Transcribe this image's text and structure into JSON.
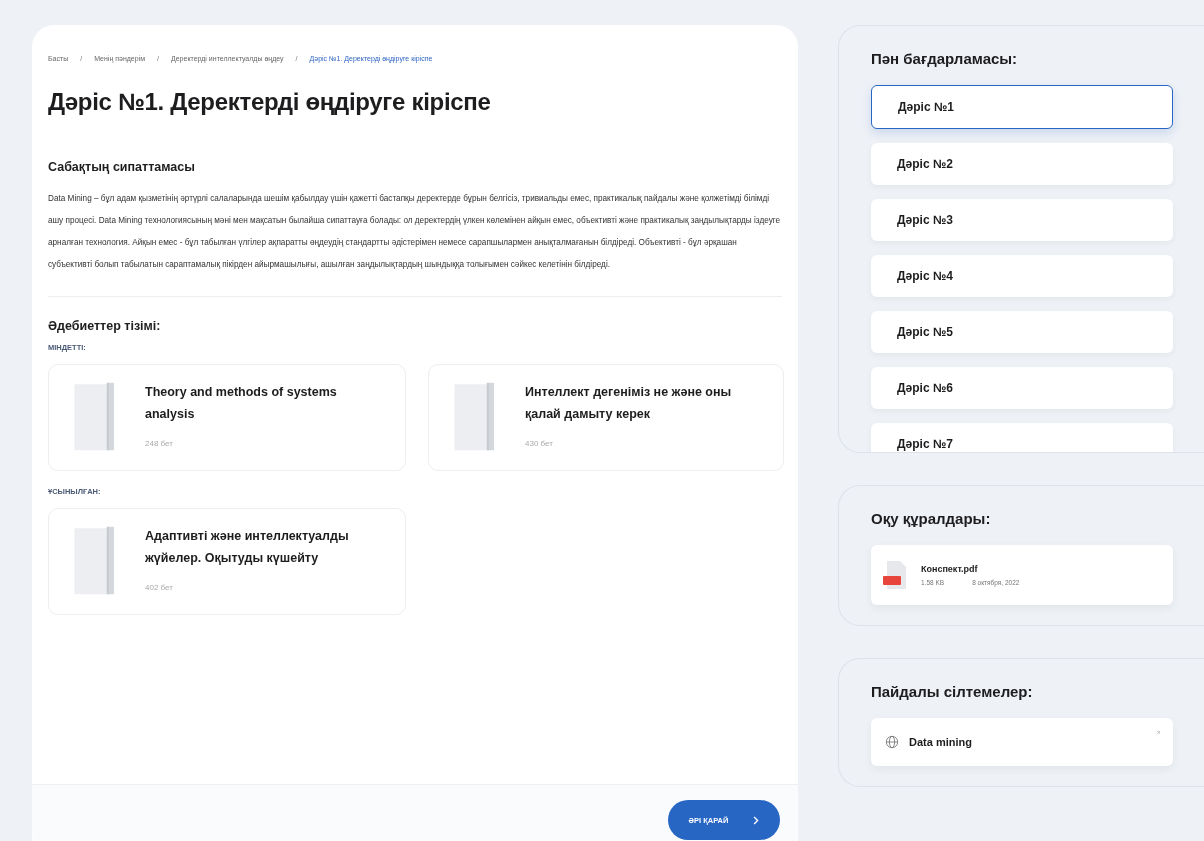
{
  "breadcrumb_separator": "/",
  "breadcrumbs": [
    {
      "label": "Басты",
      "current": false
    },
    {
      "label": "Менің пәндерім",
      "current": false
    },
    {
      "label": "Деректерді интеллектуалды өңдеу",
      "current": false
    },
    {
      "label": "Дәріс №1. Деректерді өңдіруге кіріспе",
      "current": true
    }
  ],
  "title": "Дәріс №1. Деректерді өңдіруге кіріспе",
  "description": {
    "heading": "Сабақтың сипаттамасы",
    "text": "Data Mining – бұл адам қызметінің әртүрлі салаларында шешім қабылдау үшін қажетті бастапқы деректерде бұрын белгісіз, тривиальды емес, практикалық пайдалы және қолжетімді білімді ашу процесі. Data Mining технологиясының мәні мен мақсатын былайша сипаттауға болады: ол деректердің үлкен көлемінен айқын емес, объективті және практикалық заңдылықтарды іздеуге арналған технология. Айқын емес - бұл табылған үлгілер ақпаратты өңдеудің стандартты әдістерімен немесе сарапшылармен анықталмағанын білдіреді. Объективті - бұл әрқашан субъективті болып табылатын сараптамалық пікірден айырмашылығы, ашылған заңдылықтардың шындыққа толығымен сәйкес келетінін білдіреді."
  },
  "literature": {
    "heading": "Әдебиеттер тізімі:",
    "groups": [
      {
        "label": "МІНДЕТТІ:",
        "books": [
          {
            "title": "Theory and methods of systems analysis",
            "pages": "248 бет"
          },
          {
            "title": "Интеллект дегеніміз не және оны қалай дамыту керек",
            "pages": "430 бет"
          }
        ]
      },
      {
        "label": "ҰСЫНЫЛҒАН:",
        "books": [
          {
            "title": "Адаптивті және интеллектуалды жүйелер. Оқытуды күшейту",
            "pages": "402 бет"
          }
        ]
      }
    ]
  },
  "next_button": "ӘРІ ҚАРАЙ",
  "program": {
    "heading": "Пән бағдарламасы:",
    "lessons": [
      {
        "label": "Дәріс №1",
        "selected": true
      },
      {
        "label": "Дәріс №2",
        "selected": false
      },
      {
        "label": "Дәріс №3",
        "selected": false
      },
      {
        "label": "Дәріс №4",
        "selected": false
      },
      {
        "label": "Дәріс №5",
        "selected": false
      },
      {
        "label": "Дәріс №6",
        "selected": false
      },
      {
        "label": "Дәріс №7",
        "selected": false
      }
    ]
  },
  "materials": {
    "heading": "Оқу құралдары:",
    "files": [
      {
        "name": "Конспект.pdf",
        "size": "1.58 KB",
        "date": "8 октября, 2022"
      }
    ]
  },
  "links": {
    "heading": "Пайдалы сілтемелер:",
    "items": [
      {
        "label": "Data mining"
      }
    ]
  }
}
